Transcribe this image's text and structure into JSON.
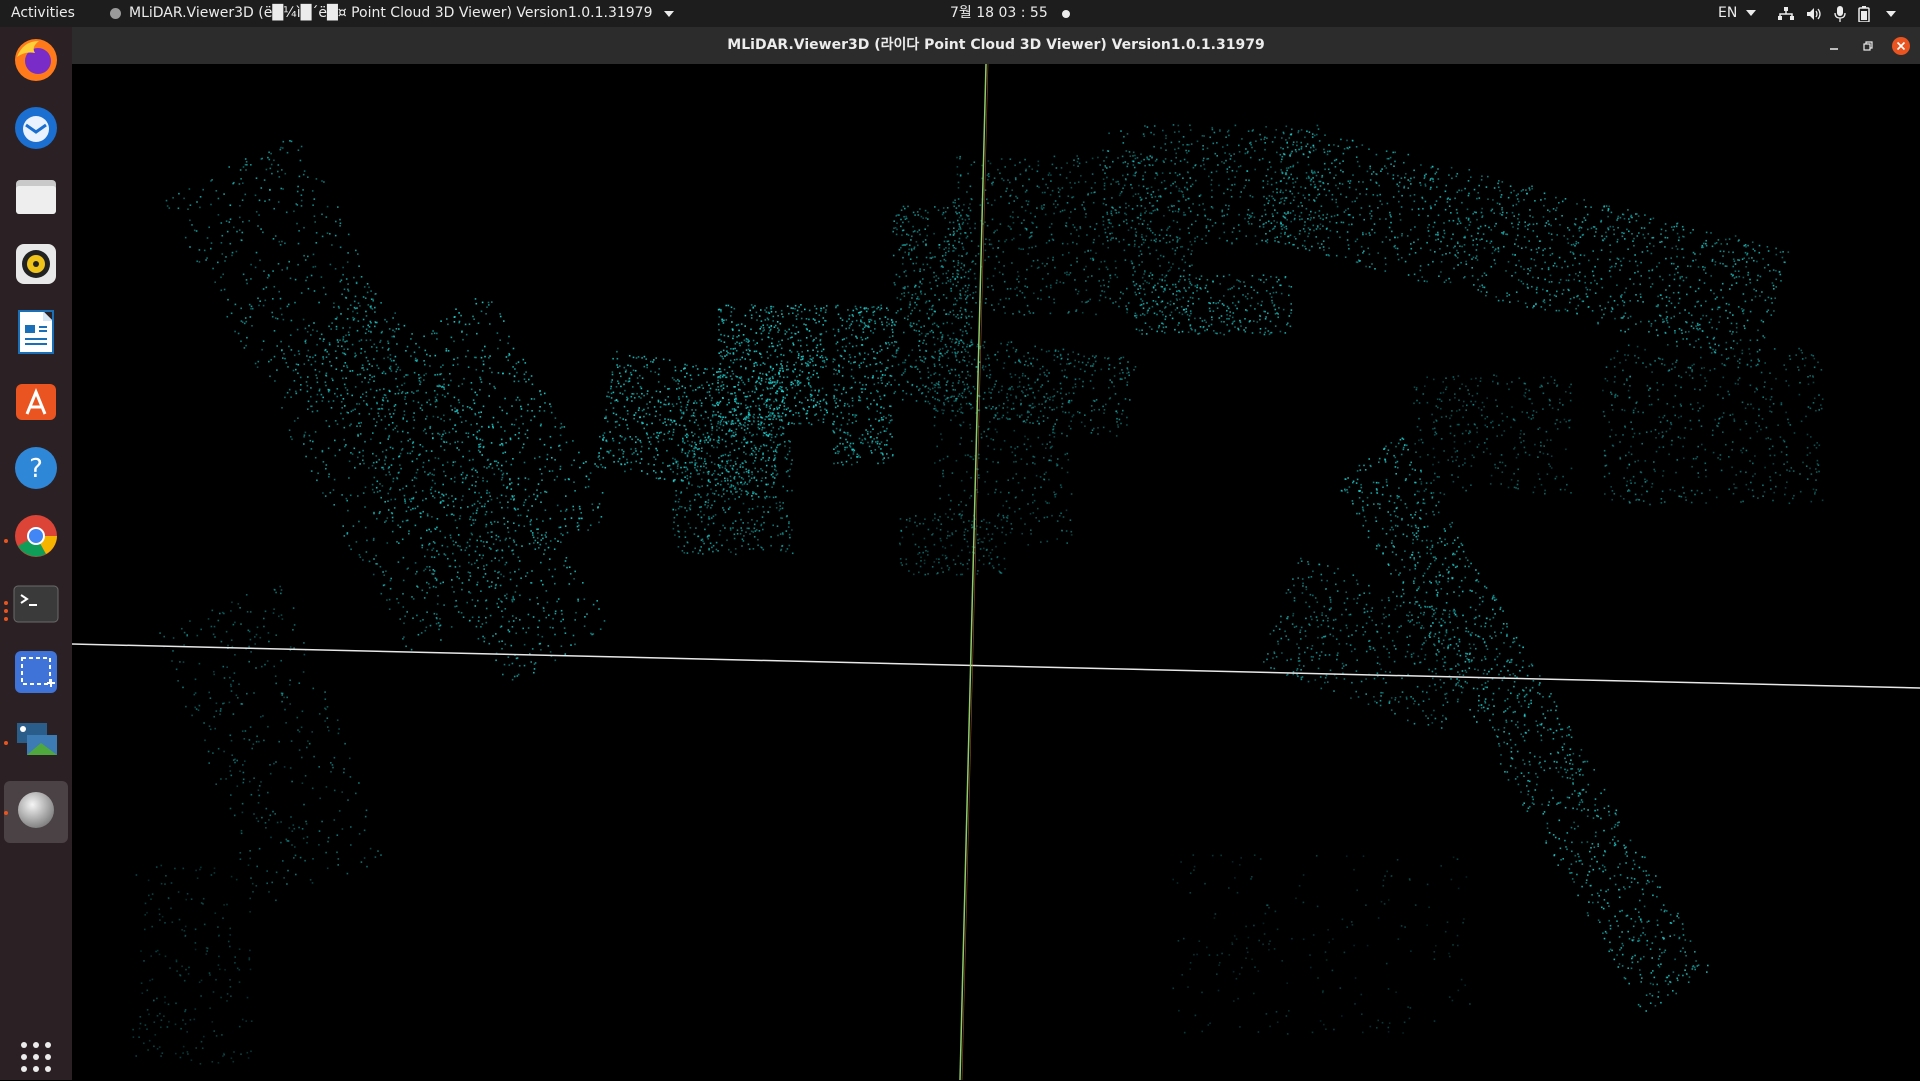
{
  "topbar": {
    "activities": "Activities",
    "app_menu_label": "MLiDAR.Viewer3D (ë█¼ì█´ë█¤ Point Cloud 3D Viewer) Version1.0.1.31979",
    "clock": "7월 18 03 : 55",
    "language": "EN"
  },
  "window": {
    "title": "MLiDAR.Viewer3D (라이다 Point Cloud 3D Viewer) Version1.0.1.31979"
  },
  "dock": {
    "items": [
      "firefox-icon",
      "thunderbird-icon",
      "files-icon",
      "rhythmbox-icon",
      "writer-icon",
      "software-icon",
      "help-icon",
      "chrome-icon",
      "terminal-icon",
      "screenshot-icon",
      "remote-desktop-icon",
      "viewer-app-icon",
      "show-apps-icon"
    ]
  },
  "colors": {
    "points": "#1fd6d6",
    "x_axis": "#e8e8e8",
    "y_axis": "#8fce6a",
    "accent": "#e95420"
  }
}
